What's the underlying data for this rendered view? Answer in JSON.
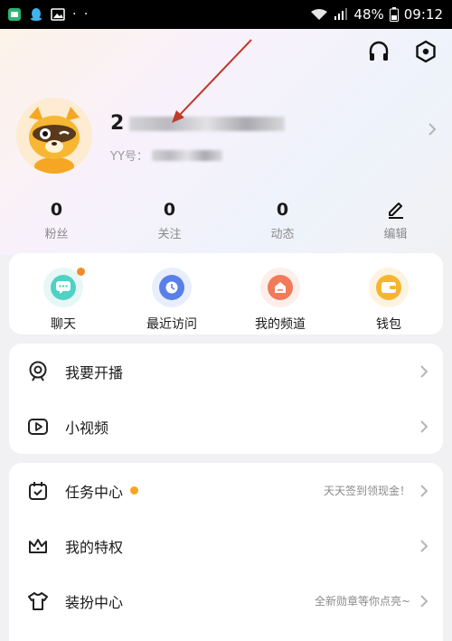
{
  "statusbar": {
    "battery": "48%",
    "time": "09:12",
    "dots": "· ·"
  },
  "profile": {
    "name_prefix": "2",
    "id_label": "YY号："
  },
  "stats": [
    {
      "value": "0",
      "label": "粉丝"
    },
    {
      "value": "0",
      "label": "关注"
    },
    {
      "value": "0",
      "label": "动态"
    },
    {
      "value": "",
      "label": "编辑"
    }
  ],
  "quick": [
    {
      "label": "聊天",
      "icon": "chat-icon"
    },
    {
      "label": "最近访问",
      "icon": "clock-icon"
    },
    {
      "label": "我的频道",
      "icon": "channel-icon"
    },
    {
      "label": "钱包",
      "icon": "wallet-icon"
    }
  ],
  "live_section": [
    {
      "label": "我要开播",
      "icon": "live-broadcast-icon"
    },
    {
      "label": "小视频",
      "icon": "video-icon"
    }
  ],
  "task_section": [
    {
      "label": "任务中心",
      "hint": "天天签到领现金！",
      "icon": "calendar-icon"
    },
    {
      "label": "我的特权",
      "hint": "",
      "icon": "crown-icon"
    },
    {
      "label": "装扮中心",
      "hint": "全新勋章等你点亮~",
      "icon": "tshirt-icon"
    }
  ],
  "colors": {
    "accent_orange": "#f28c28",
    "task_dot": "#f5a623",
    "pointer_red": "#c0392b"
  }
}
